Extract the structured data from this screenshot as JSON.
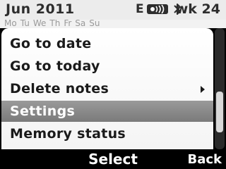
{
  "status_bar": {
    "month": "Jun 2011",
    "network": "E",
    "week": "wk 24"
  },
  "week_strip": {
    "days": [
      "Mo",
      "Tu",
      "We",
      "Th",
      "Fr",
      "Sa",
      "Su"
    ]
  },
  "menu": {
    "items": [
      {
        "label": "Go to date"
      },
      {
        "label": "Go to today"
      },
      {
        "label": "Delete notes"
      },
      {
        "label": "Settings"
      },
      {
        "label": "Memory status"
      }
    ],
    "selected_item": "Settings"
  },
  "softkeys": {
    "middle": "Select",
    "right": "Back"
  },
  "colors": {
    "selection": "#8a8a8a",
    "menu_bg": "#ffffff",
    "status_bg": "#ececec"
  },
  "icons": [
    "signal-icon",
    "bluetooth-icon",
    "submenu-arrow-icon"
  ]
}
